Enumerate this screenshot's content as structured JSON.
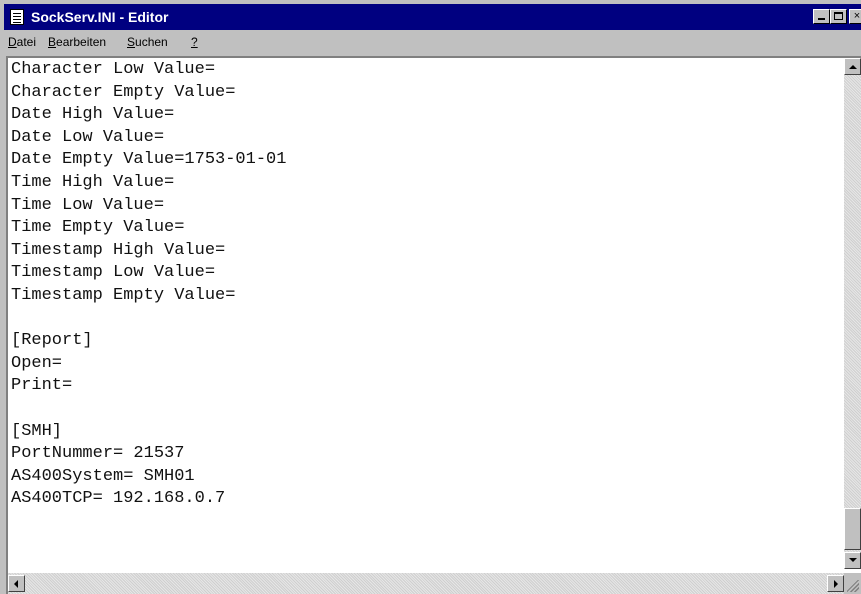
{
  "window": {
    "title": "SockServ.INI - Editor",
    "title_bar_color": "#000080",
    "icon": "notepad-icon",
    "controls": {
      "minimize_icon": "minimize-icon",
      "maximize_icon": "maximize-icon",
      "close_label": "×"
    }
  },
  "menu": {
    "items": [
      {
        "prefix": "",
        "accel": "D",
        "rest": "atei"
      },
      {
        "prefix": "",
        "accel": "B",
        "rest": "earbeiten"
      },
      {
        "prefix": "",
        "accel": "S",
        "rest": "uchen"
      },
      {
        "prefix": "",
        "accel": "?",
        "rest": ""
      }
    ]
  },
  "editor": {
    "content": "Character Low Value=\nCharacter Empty Value=\nDate High Value=\nDate Low Value=\nDate Empty Value=1753-01-01\nTime High Value=\nTime Low Value=\nTime Empty Value=\nTimestamp High Value=\nTimestamp Low Value=\nTimestamp Empty Value=\n\n[Report]\nOpen=\nPrint=\n\n[SMH]\nPortNummer= 21537\nAS400System= SMH01\nAS400TCP= 192.168.0.7"
  },
  "scrollbars": {
    "vertical_position": 0.94,
    "icons": [
      "arrow-up-icon",
      "arrow-down-icon",
      "arrow-left-icon",
      "arrow-right-icon",
      "size-grip-icon"
    ]
  }
}
